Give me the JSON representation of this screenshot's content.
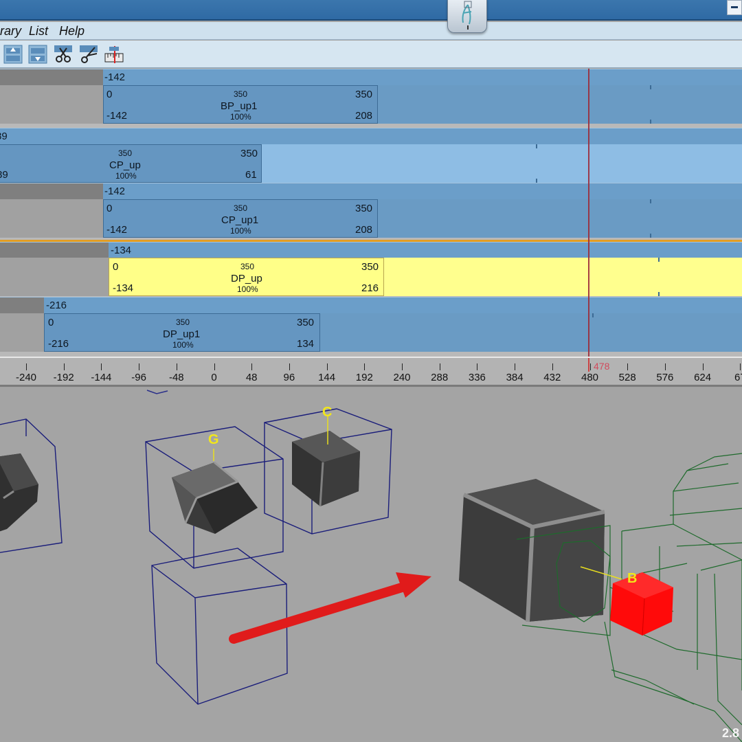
{
  "menu": {
    "items": [
      "rary",
      "List",
      "Help"
    ]
  },
  "toolbar": {
    "buttons": [
      "move-up-icon",
      "move-down-icon",
      "cut-clip-icon",
      "split-clip-icon",
      "timeline-ruler-icon"
    ]
  },
  "tracks": [
    {
      "header": "-142",
      "clip": {
        "start": "0",
        "mid_top": "350",
        "end_top": "350",
        "name": "BP_up1",
        "pct": "100%",
        "left_bottom": "-142",
        "end_bottom": "208"
      }
    },
    {
      "header": "89",
      "clip": {
        "mid_top": "350",
        "end_top": "350",
        "name": "CP_up",
        "pct": "100%",
        "left_bottom": "89",
        "end_bottom": "61"
      }
    },
    {
      "header": "-142",
      "clip": {
        "start": "0",
        "mid_top": "350",
        "end_top": "350",
        "name": "CP_up1",
        "pct": "100%",
        "left_bottom": "-142",
        "end_bottom": "208"
      }
    },
    {
      "header": "-134",
      "clip": {
        "start": "0",
        "mid_top": "350",
        "end_top": "350",
        "name": "DP_up",
        "pct": "100%",
        "left_bottom": "-134",
        "end_bottom": "216"
      }
    },
    {
      "header": "-216",
      "clip": {
        "start": "0",
        "mid_top": "350",
        "end_top": "350",
        "name": "DP_up1",
        "pct": "100%",
        "left_bottom": "-216",
        "end_bottom": "134"
      }
    }
  ],
  "ruler": {
    "labels": [
      "-240",
      "-192",
      "-144",
      "-96",
      "-48",
      "0",
      "48",
      "96",
      "144",
      "192",
      "240",
      "288",
      "336",
      "384",
      "432",
      "480",
      "528",
      "576",
      "624",
      "67"
    ],
    "current_frame": "478"
  },
  "viewport": {
    "labels": {
      "g": "G",
      "c": "C",
      "b": "B"
    },
    "corner": "2.8"
  },
  "colors": {
    "selected_track": "#ffff88",
    "clip": "#6596c1",
    "playhead": "#9c2b3a",
    "target_cube": "#ff0a0a"
  }
}
